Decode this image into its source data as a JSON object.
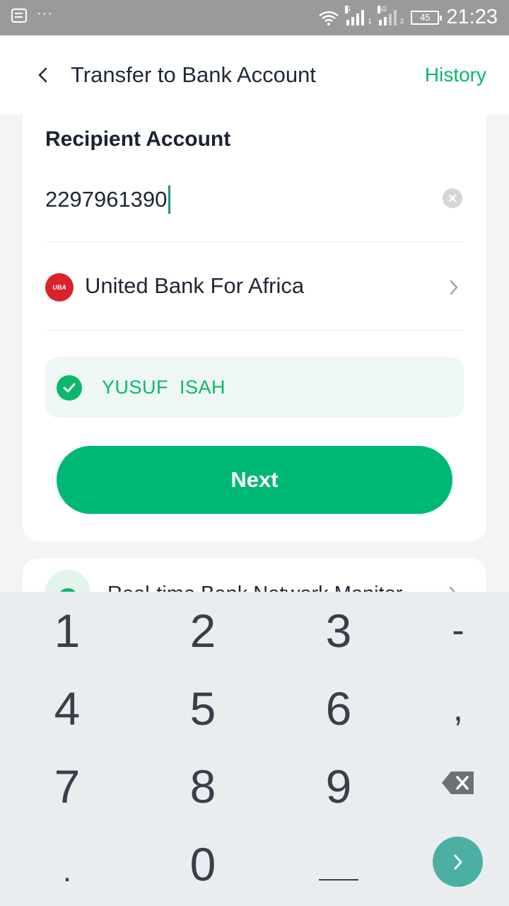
{
  "status_bar": {
    "time": "21:23",
    "battery": "45",
    "sim1_tag": "G",
    "sim1_sub": "1",
    "sim2_tag": "4G",
    "sim2_sub": "2",
    "dots": "···",
    "icons": [
      "message-icon",
      "wifi-icon",
      "signal-icon",
      "battery-icon"
    ]
  },
  "header": {
    "title": "Transfer to Bank Account",
    "history_label": "History"
  },
  "form": {
    "section_label": "Recipient Account",
    "account_number": "2297961390",
    "bank": {
      "logo_text": "UBA",
      "name": "United Bank For Africa"
    },
    "verified_name": "YUSUF  ISAH",
    "next_label": "Next"
  },
  "monitor": {
    "label": "Real-time Bank Network Monitor"
  },
  "keypad": {
    "keys": [
      "1",
      "2",
      "3",
      "-",
      "4",
      "5",
      "6",
      ",",
      "7",
      "8",
      "9",
      "0"
    ],
    "dot_key": ".",
    "space_key": "__"
  },
  "colors": {
    "accent": "#00b876",
    "accent_text": "#0cb76c",
    "statusbar": "#9a9a9a",
    "keypad_bg": "#eaedf0",
    "go_button": "#4bb0a3",
    "uba_red": "#d8232a"
  }
}
